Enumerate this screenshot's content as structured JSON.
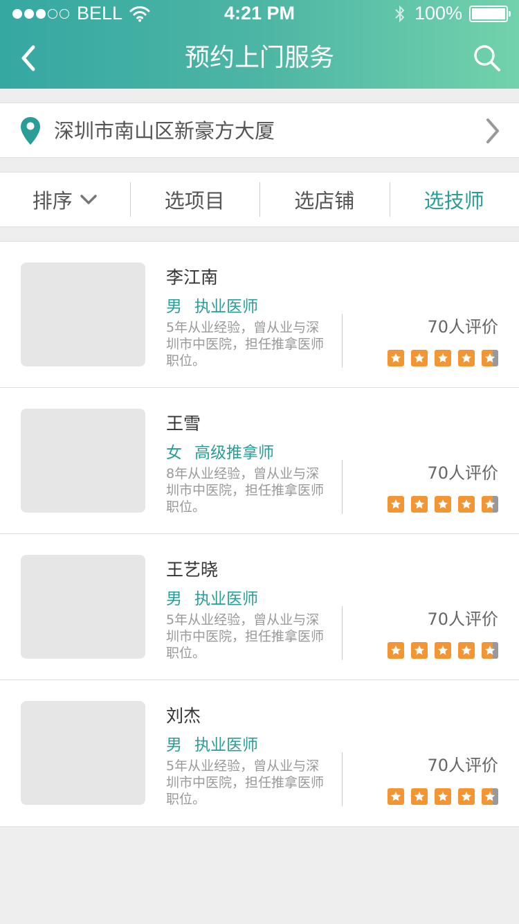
{
  "status": {
    "carrier": "BELL",
    "time": "4:21 PM",
    "battery": "100%"
  },
  "nav": {
    "title": "预约上门服务",
    "back_icon": "chevron-left-icon",
    "search_icon": "search-icon"
  },
  "location": {
    "address": "深圳市南山区新豪方大厦",
    "pin_icon": "map-pin-icon"
  },
  "filters": [
    {
      "label": "排序",
      "active": false
    },
    {
      "label": "选项目",
      "active": false
    },
    {
      "label": "选店铺",
      "active": false
    },
    {
      "label": "选技师",
      "active": true
    }
  ],
  "technicians": [
    {
      "name": "李江南",
      "gender": "男",
      "title": "执业医师",
      "desc": "5年从业经验，曾从业与深圳市中医院，担任推拿医师职位。",
      "reviews": "70人评价",
      "rating": 4.5
    },
    {
      "name": "王雪",
      "gender": "女",
      "title": "高级推拿师",
      "desc": "8年从业经验，曾从业与深圳市中医院，担任推拿医师职位。",
      "reviews": "70人评价",
      "rating": 4.5
    },
    {
      "name": "王艺晓",
      "gender": "男",
      "title": "执业医师",
      "desc": "5年从业经验，曾从业与深圳市中医院，担任推拿医师职位。",
      "reviews": "70人评价",
      "rating": 4.5
    },
    {
      "name": "刘杰",
      "gender": "男",
      "title": "执业医师",
      "desc": "5年从业经验，曾从业与深圳市中医院，担任推拿医师职位。",
      "reviews": "70人评价",
      "rating": 4.5
    }
  ],
  "colors": {
    "accent": "#2a9d96",
    "header_start": "#35a8a2",
    "header_end": "#72d2ac",
    "star": "#f39533"
  }
}
